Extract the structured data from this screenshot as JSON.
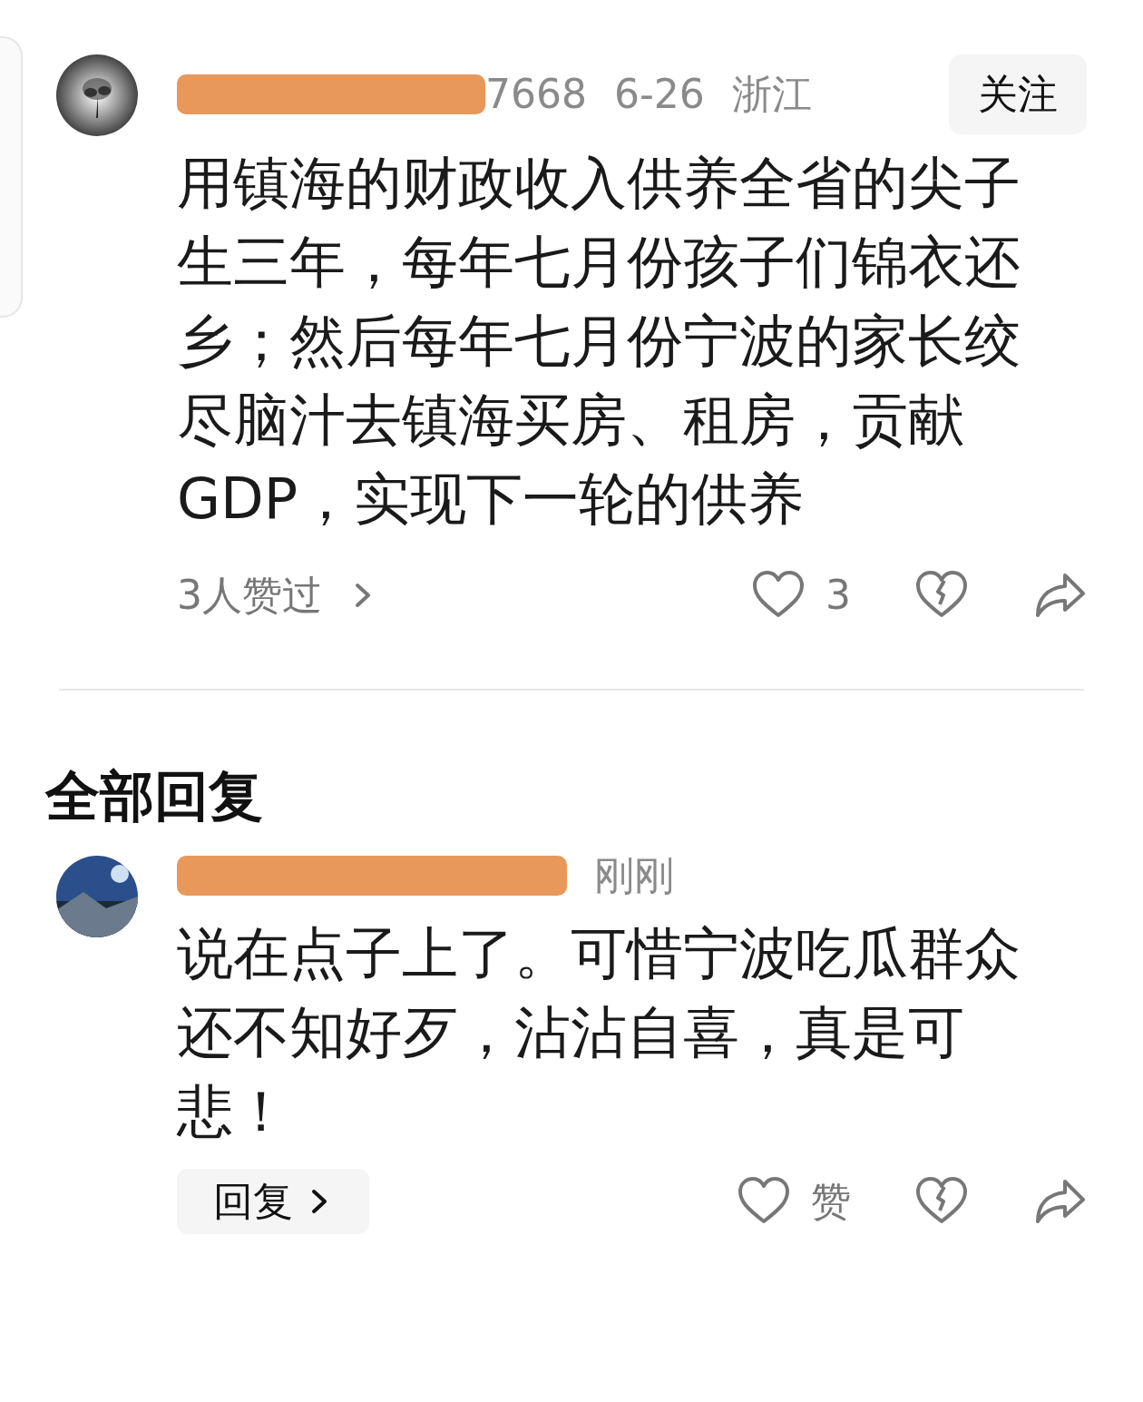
{
  "comment": {
    "username_tail": "7668",
    "date": "6-26",
    "location": "浙江",
    "follow_button": "关注",
    "text": "用镇海的财政收入供养全省的尖子生三年，每年七月份孩子们锦衣还乡；然后每年七月份宁波的家长绞尽脑汁去镇海买房、租房，贡献GDP，实现下一轮的供养",
    "likers": "3人赞过",
    "like_count": "3"
  },
  "replies_heading": "全部回复",
  "replies": [
    {
      "time": "刚刚",
      "text": "说在点子上了。可惜宁波吃瓜群众还不知好歹，沾沾自喜，真是可悲！",
      "reply_button": "回复",
      "like_label": "赞"
    }
  ]
}
